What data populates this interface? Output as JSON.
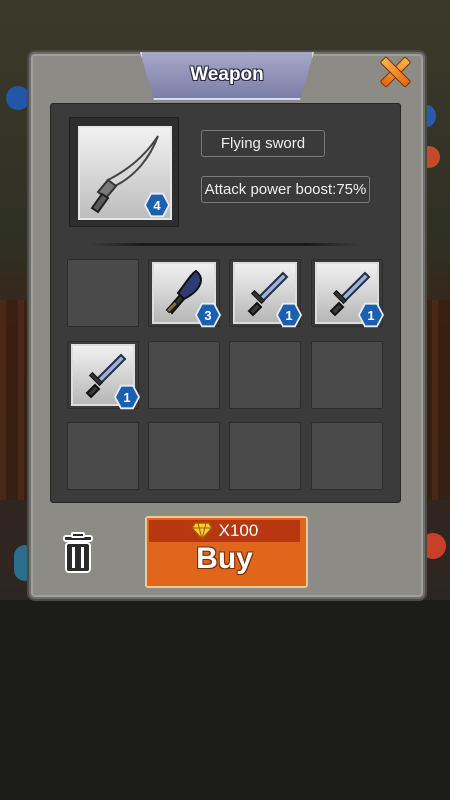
{
  "dialog": {
    "title": "Weapon",
    "close_icon": "close-x-icon"
  },
  "selected_item": {
    "name": "Flying sword",
    "effect": "Attack power boost:75%",
    "level": "4",
    "icon": "curved-blade-icon"
  },
  "inventory": {
    "slots": [
      {
        "filled": false
      },
      {
        "filled": true,
        "icon": "dark-blade-icon",
        "level": "3"
      },
      {
        "filled": true,
        "icon": "sword-icon",
        "level": "1"
      },
      {
        "filled": true,
        "icon": "sword-icon",
        "level": "1"
      },
      {
        "filled": true,
        "icon": "sword-icon",
        "level": "1"
      },
      {
        "filled": false
      },
      {
        "filled": false
      },
      {
        "filled": false
      },
      {
        "filled": false
      },
      {
        "filled": false
      },
      {
        "filled": false
      },
      {
        "filled": false
      }
    ]
  },
  "actions": {
    "price": "X100",
    "price_icon": "diamond-gem-icon",
    "buy_label": "Buy",
    "trash_icon": "trash-can-icon"
  },
  "colors": {
    "accent": "#e0661b",
    "price_bar": "#b63710",
    "level_badge": "#1b5fb0",
    "tab": "#8f91b8"
  }
}
